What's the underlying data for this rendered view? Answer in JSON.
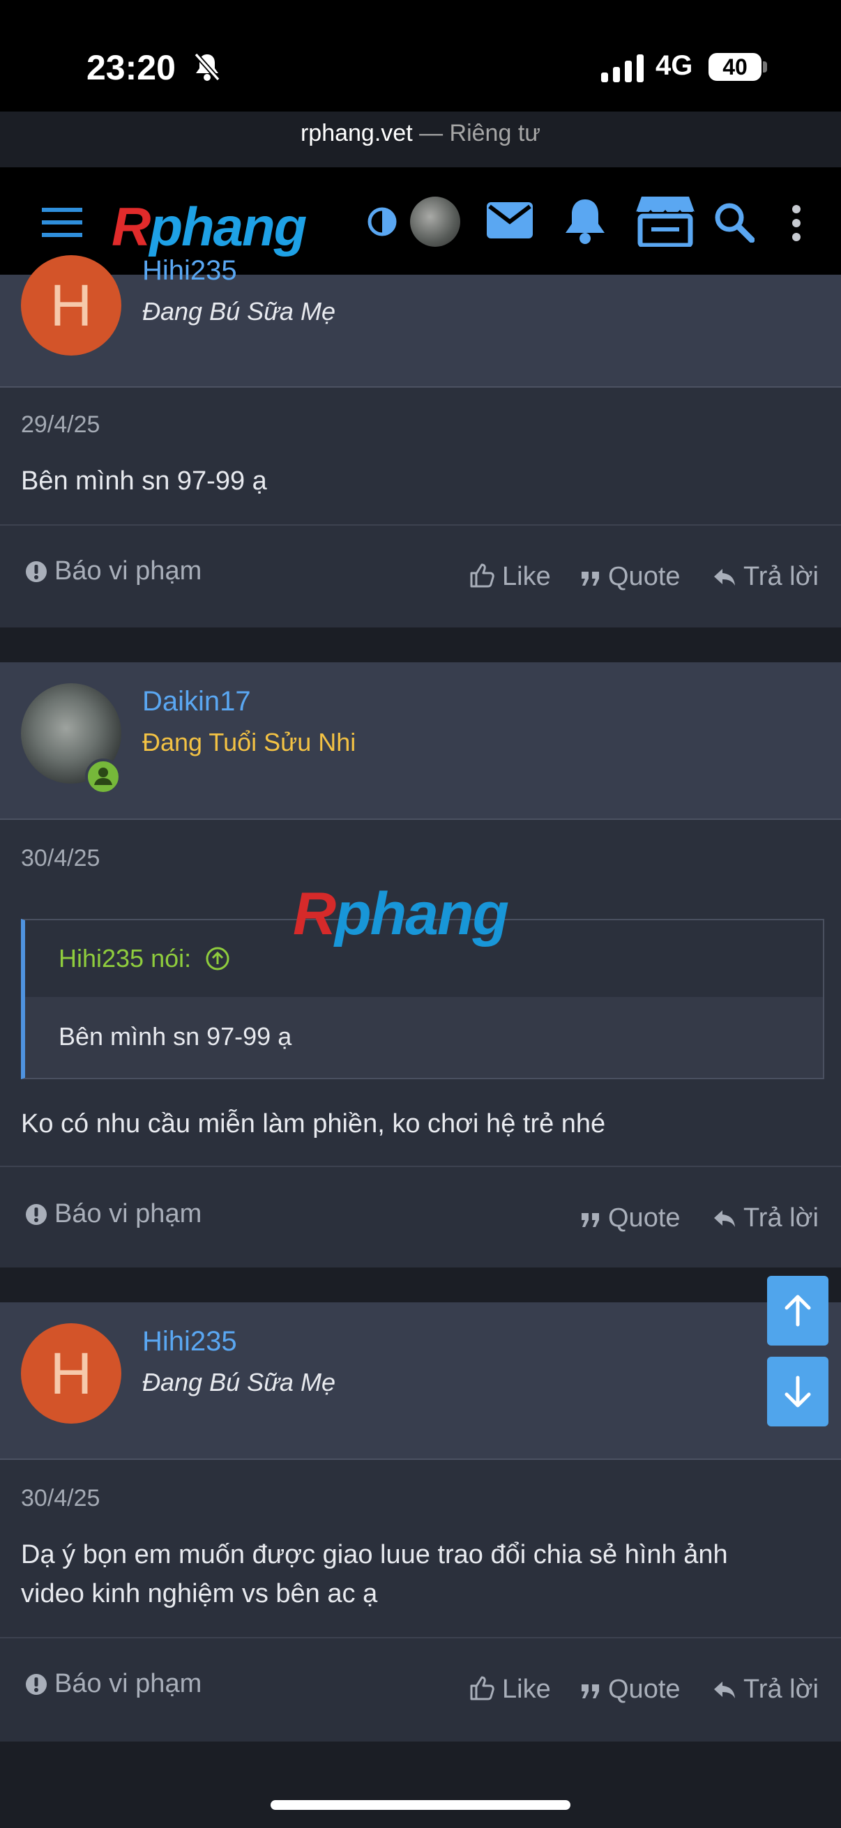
{
  "status_bar": {
    "time": "23:20",
    "network": "4G",
    "battery": "40"
  },
  "browser": {
    "domain": "rphang.vet",
    "private_label": " — Riêng tư"
  },
  "site": {
    "logo_first": "R",
    "logo_rest": "phang"
  },
  "watermark": {
    "first": "R",
    "rest": "phang"
  },
  "posts": [
    {
      "username": "Hihi235",
      "user_title": "Đang Bú Sữa Mẹ",
      "avatar_letter": "H",
      "date": "29/4/25",
      "message": "Bên mình sn 97-99 ạ",
      "actions": {
        "report": "Báo vi phạm",
        "like": "Like",
        "quote": "Quote",
        "reply": "Trả lời"
      }
    },
    {
      "username": "Daikin17",
      "user_title": "Đang Tuổi Sửu Nhi",
      "date": "30/4/25",
      "quote": {
        "author": "Hihi235 nói:",
        "text": "Bên mình sn 97-99 ạ"
      },
      "message": "Ko có nhu cầu miễn làm phiền, ko chơi hệ trẻ nhé",
      "actions": {
        "report": "Báo vi phạm",
        "quote": "Quote",
        "reply": "Trả lời"
      }
    },
    {
      "username": "Hihi235",
      "user_title": "Đang Bú Sữa Mẹ",
      "avatar_letter": "H",
      "date": "30/4/25",
      "message_line1": "Dạ ý bọn em muốn được giao luue trao đổi chia sẻ hình ảnh",
      "message_line2": "video kinh nghiệm vs bên ac ạ",
      "actions": {
        "report": "Báo vi phạm",
        "like": "Like",
        "quote": "Quote",
        "reply": "Trả lời"
      }
    }
  ]
}
